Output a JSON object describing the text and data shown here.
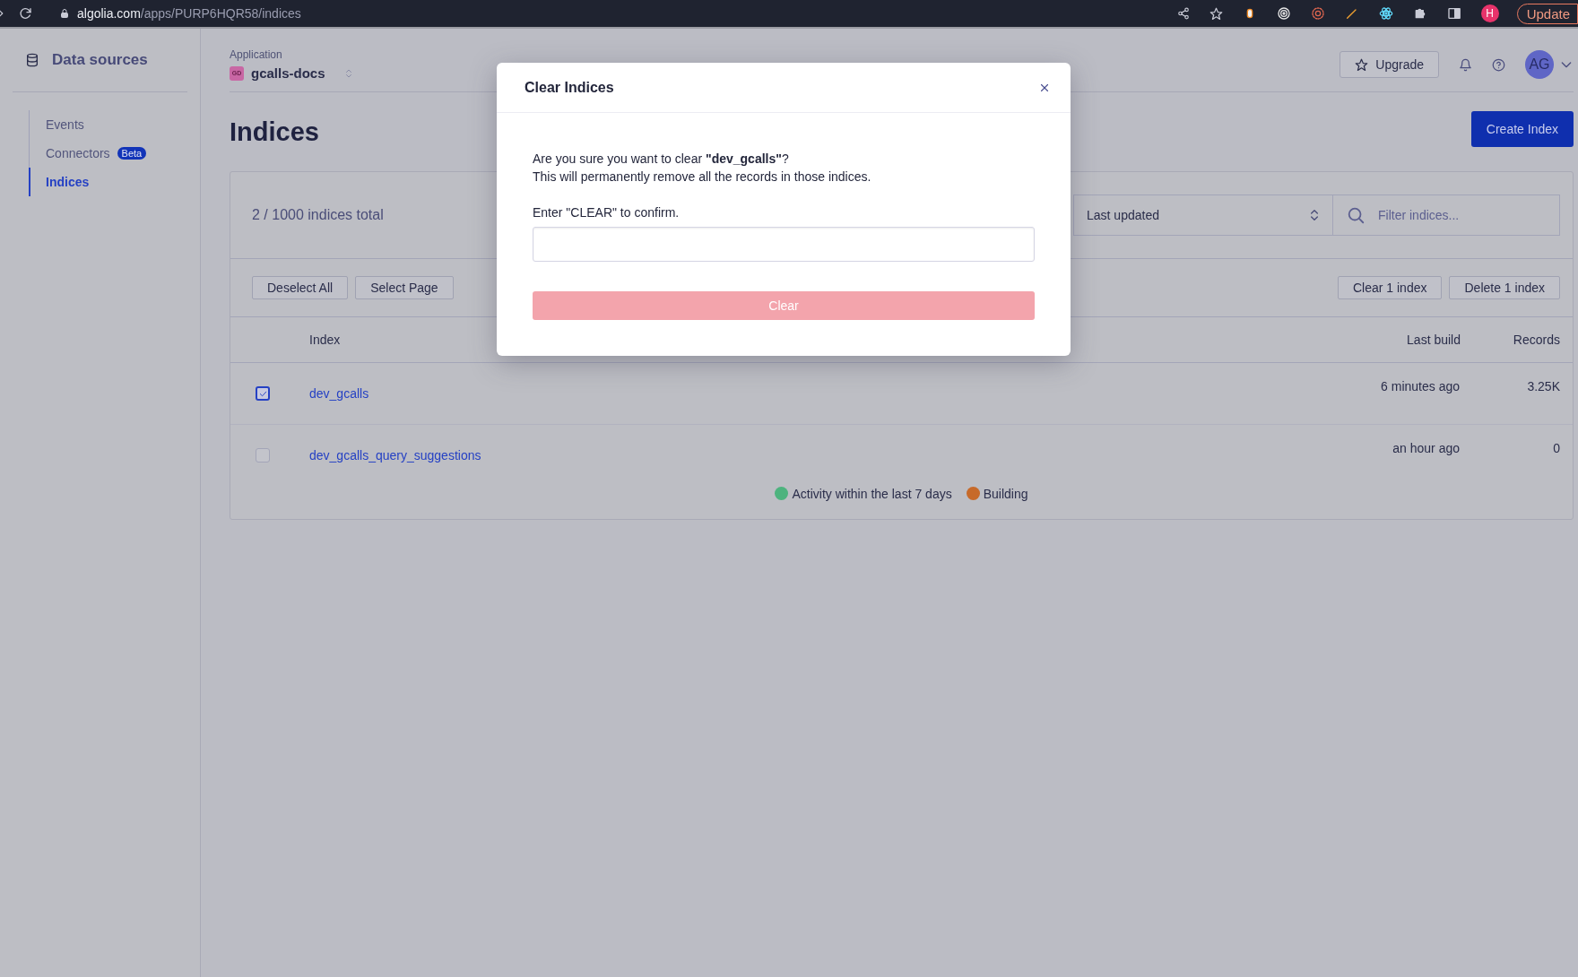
{
  "browser": {
    "url_domain": "algolia.com",
    "url_path": "/apps/PURP6HQR58/indices",
    "profile_initial": "H",
    "update_button": "Update"
  },
  "sidebar": {
    "title": "Data sources",
    "items": [
      {
        "label": "Events",
        "selected": false
      },
      {
        "label": "Connectors",
        "badge": "Beta",
        "selected": false
      },
      {
        "label": "Indices",
        "selected": true
      }
    ]
  },
  "header": {
    "app_label": "Application",
    "app_badge": "GD",
    "app_name": "gcalls-docs",
    "upgrade_button": "Upgrade",
    "avatar": "AG"
  },
  "page": {
    "title": "Indices",
    "create_button": "Create Index"
  },
  "card": {
    "count": "2 / 1000 indices total",
    "sort": "Last updated",
    "filter_placeholder": "Filter indices...",
    "left_buttons": [
      "Deselect All",
      "Select Page"
    ],
    "right_buttons": [
      "Clear 1 index",
      "Delete 1 index"
    ],
    "columns": [
      "Index",
      "Last build",
      "Records"
    ],
    "rows": [
      {
        "checked": true,
        "name": "dev_gcalls",
        "last_build": "6 minutes ago",
        "records": "3.25K"
      },
      {
        "checked": false,
        "name": "dev_gcalls_query_suggestions",
        "last_build": "an hour ago",
        "records": "0"
      }
    ],
    "legend": [
      {
        "label": "Activity within the last 7 days",
        "color": "#4db37e"
      },
      {
        "label": "Building",
        "color": "#c76a2a"
      }
    ]
  },
  "modal": {
    "title": "Clear Indices",
    "message": "Are you sure you want to clear **\"dev_gcalls\"**?",
    "message_2": "This will permanently remove all the records in those indices.",
    "confirm_label": "Enter \"CLEAR\" to confirm.",
    "button": "Clear",
    "button_disabled": true
  }
}
